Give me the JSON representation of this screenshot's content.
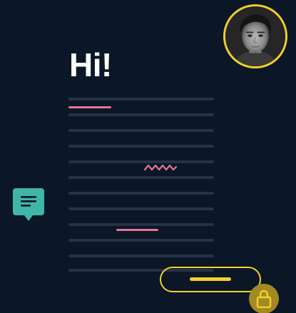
{
  "greeting": "Hi!",
  "colors": {
    "background": "#0b1626",
    "accent_yellow": "#f2d12b",
    "accent_pink": "#e5739a",
    "teal": "#3fb6a8",
    "placeholder_line": "#263344"
  },
  "icons": {
    "avatar": "avatar-photo",
    "comment": "chat-bubble-icon",
    "lock": "lock-icon"
  }
}
